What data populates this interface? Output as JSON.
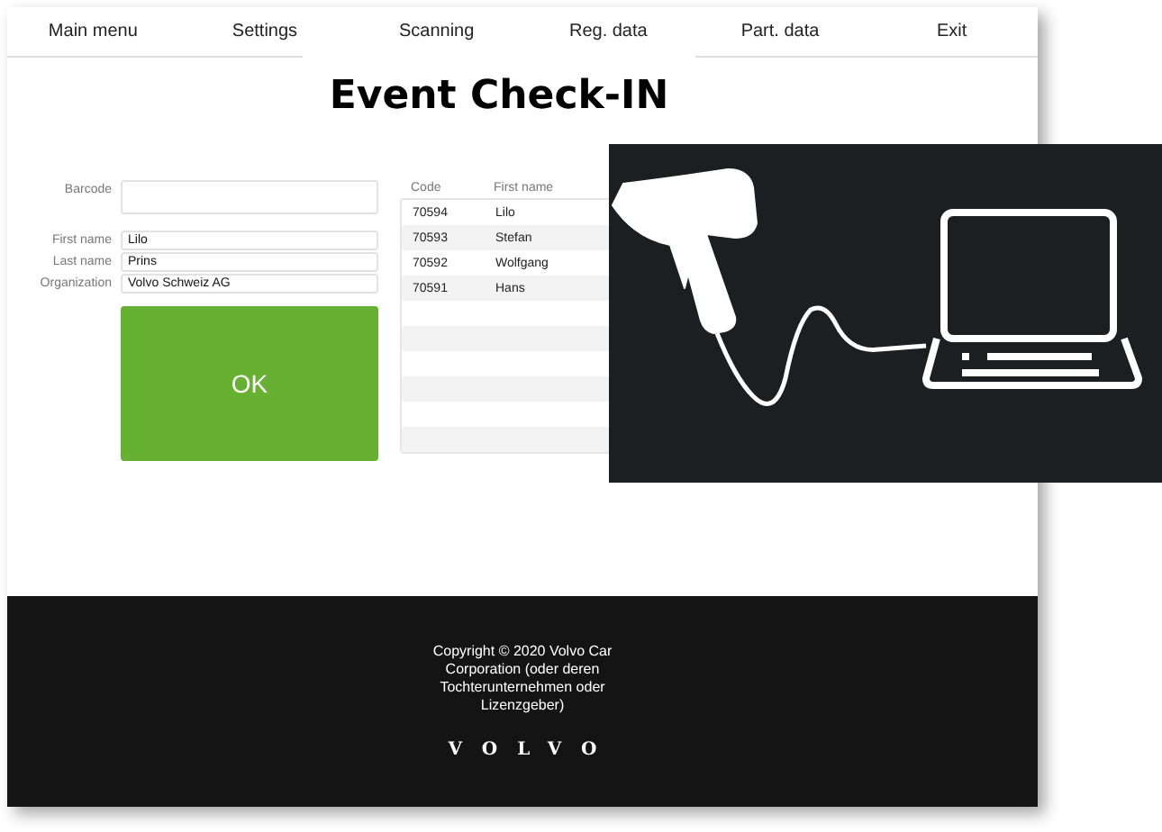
{
  "nav": [
    "Main menu",
    "Settings",
    "Scanning",
    "Reg. data",
    "Part. data",
    "Exit"
  ],
  "title": "Event Check-IN",
  "form": {
    "barcode": {
      "label": "Barcode"
    },
    "fields": [
      {
        "label": "First name",
        "value": "Lilo"
      },
      {
        "label": "Last name",
        "value": "Prins"
      },
      {
        "label": "Organization",
        "value": "Volvo Schweiz AG"
      }
    ],
    "ok_button": "OK"
  },
  "table": {
    "columns": [
      "Code",
      "First name"
    ],
    "rows": [
      [
        "70594",
        "Lilo"
      ],
      [
        "70593",
        "Stefan"
      ],
      [
        "70592",
        "Wolfgang"
      ],
      [
        "70591",
        "Hans"
      ]
    ]
  },
  "overlay": {
    "kind": "illustration"
  },
  "footer": {
    "copyright": "Copyright © 2020 Volvo Car Corporation (oder deren Tochterunternehmen oder Lizenzgeber)",
    "logo": "VOLVO"
  }
}
